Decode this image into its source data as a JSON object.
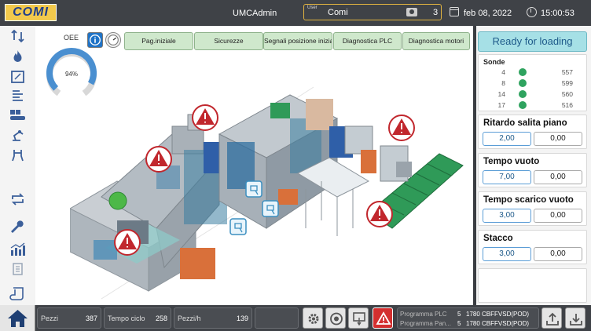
{
  "header": {
    "logo_text": "COMI",
    "user_name": "UMCAdmin",
    "user_field_label": "User",
    "user_field_value": "Comi",
    "user_level": "3",
    "date": "feb 08, 2022",
    "time": "15:00:53"
  },
  "main": {
    "oee_label": "OEE",
    "oee_value": "94%",
    "oee_fraction": 0.94,
    "tabs": [
      {
        "label": "Pag.iniziale"
      },
      {
        "label": "Sicurezze"
      },
      {
        "label": "Segnali posizione iniziale"
      },
      {
        "label": "Diagnostica PLC"
      },
      {
        "label": "Diagnostica motori"
      }
    ]
  },
  "status": {
    "ready_label": "Ready for loading"
  },
  "sonde": {
    "title": "Sonde",
    "rows": [
      {
        "id": "4",
        "value": "557"
      },
      {
        "id": "8",
        "value": "599"
      },
      {
        "id": "14",
        "value": "560"
      },
      {
        "id": "17",
        "value": "516"
      }
    ]
  },
  "params": [
    {
      "title": "Ritardo salita piano",
      "set": "2,00",
      "actual": "0,00"
    },
    {
      "title": "Tempo vuoto",
      "set": "7,00",
      "actual": "0,00"
    },
    {
      "title": "Tempo scarico vuoto",
      "set": "3,00",
      "actual": "0,00"
    },
    {
      "title": "Stacco",
      "set": "3,00",
      "actual": "0,00"
    }
  ],
  "footer": {
    "counters": [
      {
        "label": "Pezzi",
        "value": "387"
      },
      {
        "label": "Tempo ciclo",
        "value": "258"
      },
      {
        "label": "Pezzi/h",
        "value": "139"
      }
    ],
    "programs": [
      {
        "label": "Programma PLC",
        "num": "5",
        "value": "1780 CBFFVSD(POD)"
      },
      {
        "label": "Programma Pan...",
        "num": "5",
        "value": "1780 CBFFVSD(POD)"
      }
    ]
  },
  "colors": {
    "accent_blue": "#1f73c7",
    "ready_bg": "#a6e0e6",
    "ok_green": "#2fa35f",
    "alarm_red": "#c1272d",
    "tab_green": "#cfe8cc"
  }
}
